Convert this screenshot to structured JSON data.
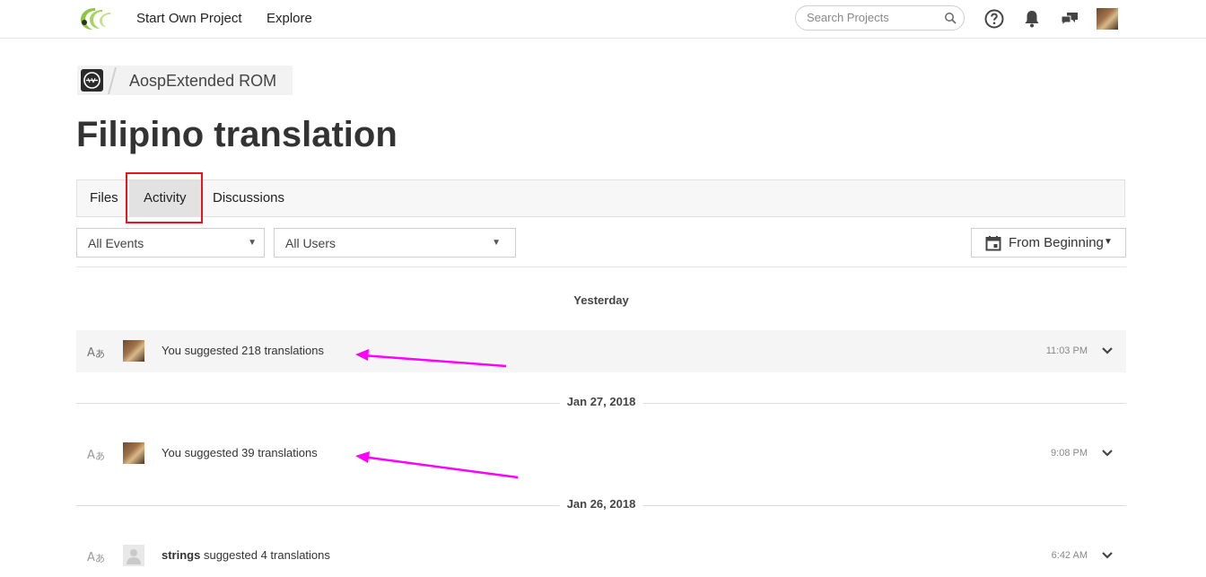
{
  "nav": {
    "start_project": "Start Own Project",
    "explore": "Explore",
    "search_placeholder": "Search Projects"
  },
  "breadcrumb": {
    "project_name": "AospExtended ROM"
  },
  "page": {
    "title": "Filipino translation"
  },
  "tabs": [
    {
      "label": "Files",
      "active": false
    },
    {
      "label": "Activity",
      "active": true
    },
    {
      "label": "Discussions",
      "active": false
    }
  ],
  "filters": {
    "events": "All Events",
    "users": "All Users",
    "date_range": "From Beginning"
  },
  "activity": {
    "groups": [
      {
        "date": "Yesterday",
        "items": [
          {
            "actor": "You",
            "action": "suggested 218 translations",
            "time": "11:03 PM"
          }
        ]
      },
      {
        "date": "Jan 27, 2018",
        "items": [
          {
            "actor": "You",
            "action": "suggested 39 translations",
            "time": "9:08 PM"
          }
        ]
      },
      {
        "date": "Jan 26, 2018",
        "items": [
          {
            "actor": "strings",
            "action": "suggested 4 translations",
            "time": "6:42 AM"
          }
        ]
      }
    ]
  },
  "colors": {
    "highlight_box": "#e8141e",
    "annotation_arrow": "#ff00ff",
    "logo_green": "#8dc63f"
  }
}
